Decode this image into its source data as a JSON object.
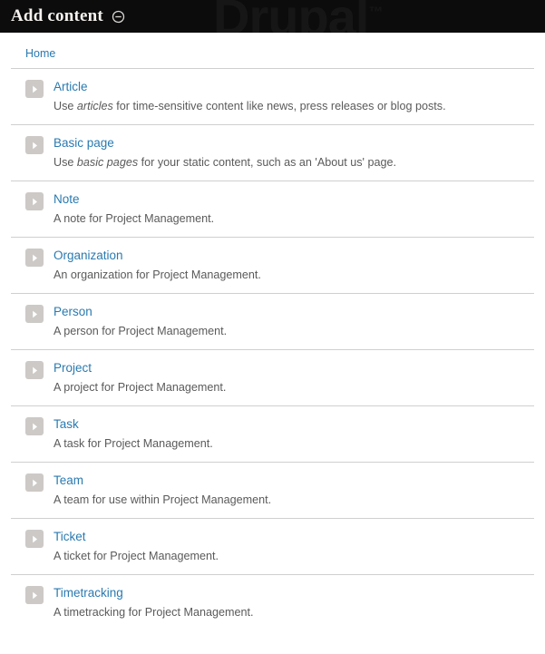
{
  "toolbar": {
    "title": "Add content",
    "collapse_icon": "circle-minus-icon",
    "watermark_text": "Drupal",
    "watermark_tm": "™"
  },
  "breadcrumb": {
    "items": [
      {
        "label": "Home",
        "name": "breadcrumb-home"
      }
    ]
  },
  "colors": {
    "toolbar_background": "#0c0c0c",
    "toolbar_title": "#f5f2ef",
    "link_blue": "#2a7ab0",
    "description_text": "#5a5a5a",
    "divider": "#cfcfcf",
    "icon_background": "#ccc9c6",
    "icon_glyph": "#ffffff",
    "page_background": "#ffffff"
  },
  "content_types": [
    {
      "title": "Article",
      "icon": "chevron-right-icon",
      "desc_parts": [
        {
          "text": "Use ",
          "italic": false
        },
        {
          "text": "articles",
          "italic": true
        },
        {
          "text": " for time-sensitive content like news, press releases or blog posts.",
          "italic": false
        }
      ]
    },
    {
      "title": "Basic page",
      "icon": "chevron-right-icon",
      "desc_parts": [
        {
          "text": "Use ",
          "italic": false
        },
        {
          "text": "basic pages",
          "italic": true
        },
        {
          "text": " for your static content, such as an 'About us' page.",
          "italic": false
        }
      ]
    },
    {
      "title": "Note",
      "icon": "chevron-right-icon",
      "desc_parts": [
        {
          "text": "A note for Project Management.",
          "italic": false
        }
      ]
    },
    {
      "title": "Organization",
      "icon": "chevron-right-icon",
      "desc_parts": [
        {
          "text": "An organization for Project Management.",
          "italic": false
        }
      ]
    },
    {
      "title": "Person",
      "icon": "chevron-right-icon",
      "desc_parts": [
        {
          "text": "A person for Project Management.",
          "italic": false
        }
      ]
    },
    {
      "title": "Project",
      "icon": "chevron-right-icon",
      "desc_parts": [
        {
          "text": "A project for Project Management.",
          "italic": false
        }
      ]
    },
    {
      "title": "Task",
      "icon": "chevron-right-icon",
      "desc_parts": [
        {
          "text": "A task for Project Management.",
          "italic": false
        }
      ]
    },
    {
      "title": "Team",
      "icon": "chevron-right-icon",
      "desc_parts": [
        {
          "text": "A team for use within Project Management.",
          "italic": false
        }
      ]
    },
    {
      "title": "Ticket",
      "icon": "chevron-right-icon",
      "desc_parts": [
        {
          "text": "A ticket for Project Management.",
          "italic": false
        }
      ]
    },
    {
      "title": "Timetracking",
      "icon": "chevron-right-icon",
      "desc_parts": [
        {
          "text": "A timetracking for Project Management.",
          "italic": false
        }
      ]
    }
  ]
}
